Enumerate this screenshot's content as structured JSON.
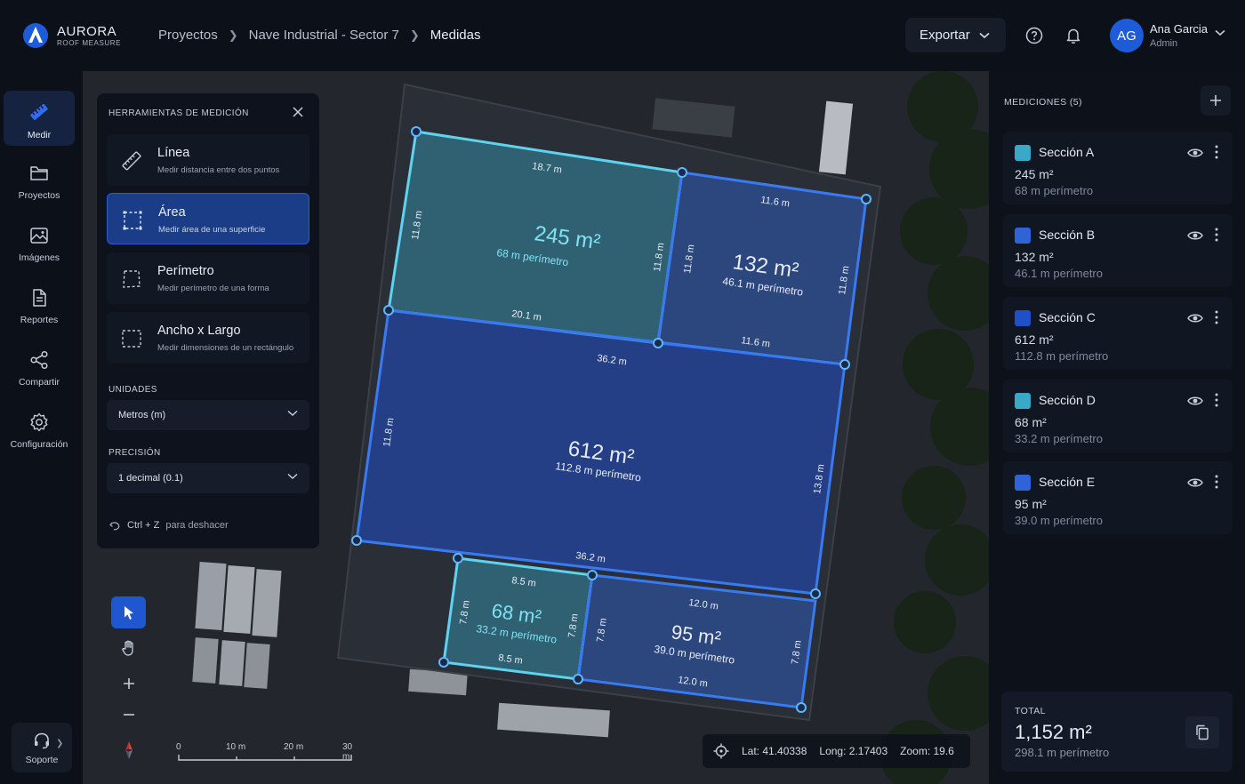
{
  "app": {
    "name": "AURORA",
    "subtitle": "ROOF MEASURE"
  },
  "breadcrumb": [
    "Proyectos",
    "Nave Industrial - Sector 7",
    "Medidas"
  ],
  "header": {
    "export_label": "Exportar",
    "user_initials": "AG",
    "user_name": "Ana Garcia",
    "user_role": "Admin"
  },
  "nav": [
    {
      "label": "Medir",
      "icon": "ruler-icon",
      "active": true
    },
    {
      "label": "Proyectos",
      "icon": "folder-icon"
    },
    {
      "label": "Imágenes",
      "icon": "image-icon"
    },
    {
      "label": "Reportes",
      "icon": "document-icon"
    },
    {
      "label": "Compartir",
      "icon": "share-icon"
    },
    {
      "label": "Configuración",
      "icon": "gear-icon"
    }
  ],
  "support_label": "Soporte",
  "tools": {
    "title": "HERRAMIENTAS DE MEDICIÓN",
    "items": [
      {
        "name": "Línea",
        "desc": "Medir distancia entre dos puntos",
        "icon": "ruler-line-icon"
      },
      {
        "name": "Área",
        "desc": "Medir área de una superficie",
        "icon": "area-icon",
        "active": true
      },
      {
        "name": "Perímetro",
        "desc": "Medir perímetro de una forma",
        "icon": "perimeter-icon"
      },
      {
        "name": "Ancho x Largo",
        "desc": "Medir dimensiones de un rectángulo",
        "icon": "rectangle-icon"
      }
    ],
    "units_label": "UNIDADES",
    "units_value": "Metros (m)",
    "precision_label": "PRECISIÓN",
    "precision_value": "1 decimal (0.1)",
    "undo_key": "Ctrl + Z",
    "undo_text": "para deshacer"
  },
  "scale": {
    "ticks": [
      "0",
      "10 m",
      "20 m",
      "30 m"
    ]
  },
  "coords": {
    "lat": "Lat: 41.40338",
    "long": "Long: 2.17403",
    "zoom": "Zoom: 19.6"
  },
  "sections": [
    {
      "name": "Sección A",
      "area": "245 m²",
      "perimeter": "68 m perímetro",
      "color": "#3aa9c7",
      "map_area": "245 m²",
      "map_perimeter": "68 m perímetro",
      "edges": [
        "18.7 m",
        "11.8 m",
        "20.1 m",
        "11.8 m"
      ]
    },
    {
      "name": "Sección B",
      "area": "132 m²",
      "perimeter": "46.1 m perímetro",
      "color": "#2f63d8",
      "map_area": "132 m²",
      "map_perimeter": "46.1 m perímetro",
      "edges": [
        "11.6 m",
        "11.8 m",
        "11.6 m",
        "11.8 m"
      ]
    },
    {
      "name": "Sección C",
      "area": "612 m²",
      "perimeter": "112.8 m perímetro",
      "color": "#1f4fc9",
      "map_area": "612 m²",
      "map_perimeter": "112.8 m perímetro",
      "edges": [
        "36.2 m",
        "13.8 m",
        "36.2 m",
        "11.8 m"
      ]
    },
    {
      "name": "Sección D",
      "area": "68 m²",
      "perimeter": "33.2 m perímetro",
      "color": "#3aa9c7",
      "map_area": "68 m²",
      "map_perimeter": "33.2 m perímetro",
      "edges": [
        "8.5 m",
        "7.8 m",
        "8.5 m",
        "7.8 m"
      ]
    },
    {
      "name": "Sección E",
      "area": "95 m²",
      "perimeter": "39.0 m perímetro",
      "color": "#2f63d8",
      "map_area": "95 m²",
      "map_perimeter": "39.0 m perímetro",
      "edges": [
        "12.0 m",
        "7.8 m",
        "12.0 m",
        "7.8 m"
      ]
    }
  ],
  "measurements_title": "MEDICIONES (5)",
  "total": {
    "label": "TOTAL",
    "area": "1,152 m²",
    "perimeter": "298.1 m perímetro"
  }
}
